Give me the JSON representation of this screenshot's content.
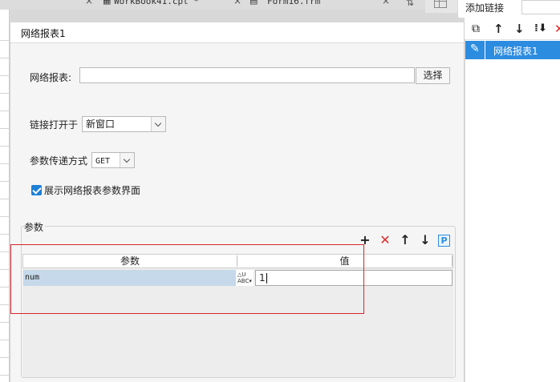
{
  "tabs": [
    {
      "label": "WorkBook41.cpt *"
    },
    {
      "label": "Form16.frm"
    }
  ],
  "dialog": {
    "title": "网络报表1",
    "report_label": "网络报表:",
    "report_value": "",
    "select_button": "选择",
    "open_in_label": "链接打开于",
    "open_in_value": "新窗口",
    "method_label": "参数传递方式",
    "method_value": "GET",
    "show_params_label": "展示网络报表参数界面",
    "show_params_checked": true,
    "params_group_title": "参数",
    "params_table": {
      "headers": [
        "参数",
        "值"
      ],
      "rows": [
        {
          "name": "num",
          "type_icon": "abc-type-icon",
          "value": "1"
        }
      ]
    }
  },
  "right_panel": {
    "title": "添加链接",
    "items": [
      {
        "label": "网络报表1",
        "icon": "pencil-icon",
        "selected": true
      }
    ]
  },
  "colors": {
    "accent": "#2c8ce0",
    "delete": "#e02b2b",
    "highlight": "#d9252a",
    "selected_row": "#c5d9ea"
  }
}
